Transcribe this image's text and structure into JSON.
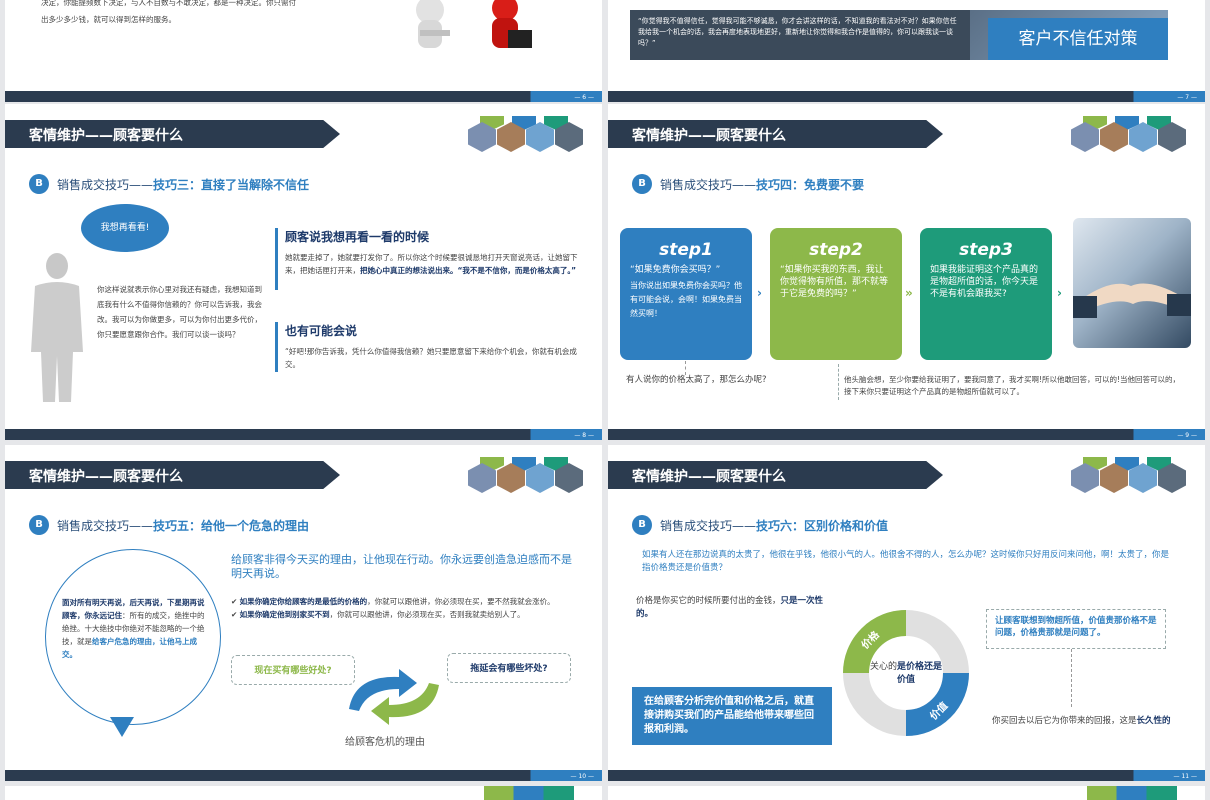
{
  "colors": {
    "navy": "#2b3b4f",
    "blue": "#2f7fc0",
    "green": "#8db84a",
    "teal": "#1e9b7a",
    "text": "#444444"
  },
  "common": {
    "section_title": "客情维护——顾客要什么",
    "badge": "B",
    "prefix": "销售成交技巧——"
  },
  "slide6": {
    "text1": "决定，你能提频数下决定，与人不自数与不敢决定，都是一种决定。你只需付",
    "text2": "出多少多少钱，就可以得到怎样的服务。",
    "page": "— 6 —"
  },
  "slide7": {
    "quote": "“你觉得我不值得信任，觉得我可能不够诚恳，你才会讲这样的话，不知道我的看法对不对？如果你信任我给我一个机会的话，我会再度地表现地更好，重新地让你觉得和我合作是值得的，你可以跟我谈一谈吗？”",
    "label": "客户不信任对策",
    "page": "— 7 —"
  },
  "slide8": {
    "tip": "技巧三：直接了当解除不信任",
    "bubble": "我想再看看!",
    "left_text": "你这样说就表示你心里对我还有疑虑，我想知道到底我有什么不值得你信赖的？你可以告诉我，我会改。我可以为你做更多，可以为你付出更多代价，你只要愿意跟你合作。我们可以谈一谈吗？",
    "h1": "顾客说我想再看一看的时候",
    "p1a": "她就要走掉了，她就要打发你了。所以你这个时候要很诚恳地打开天窗说亮话，让她留下来，把她话匣打开来，",
    "p1b": "把她心中真正的想法说出来。“我不是不信你，而是价格太高了。”",
    "h2": "也有可能会说",
    "p2": "“好吧!那你告诉我，凭什么你值得我信赖？她只要愿意留下来给你个机会，你就有机会成交。",
    "page": "— 8 —"
  },
  "slide9": {
    "tip": "技巧四：免费要不要",
    "steps": [
      {
        "title": "step1",
        "q": "“如果免费你会买吗？”",
        "a": "当你说出如果免费你会买吗？他有可能会说，会啊！如果免费当然买啊！"
      },
      {
        "title": "step2",
        "q": "“如果你买我的东西，我让你觉得物有所值，那不就等于它是免费的吗？”",
        "a": ""
      },
      {
        "title": "step3",
        "q": "如果我能证明这个产品真的是物超所值的话，你今天是不是有机会跟我买?",
        "a": ""
      }
    ],
    "bottom_left": "有人说你的价格太高了，那怎么办呢?",
    "bottom_right": "他头脑会想，至少你要给我证明了，要我同意了，我才买啊!所以他敢回答，可以的!当他回答可以的，接下来你只要证明这个产品真的是物超所值就可以了。",
    "page": "— 9 —"
  },
  "slide10": {
    "tip": "技巧五：给他一个危急的理由",
    "circle_a": "面对所有明天再说，后天再说，下星期再说顾客，你永远记住",
    "circle_b": "：所有的成交，绝挫中的绝挫。十大绝技中你绝对不能忽略的一个绝技，就是",
    "circle_c": "给客户危急的理由，让他马上成交。",
    "headline": "给顾客非得今天买的理由，让他现在行动。你永远要创造急迫感而不是明天再说。",
    "b1a": "如果你确定你给顾客的是最低的价格的",
    "b1b": "，你就可以跟他讲，你必须现在买，要不然我就会涨价。",
    "b2a": "如果你确定他到别家买不到",
    "b2b": "，你就可以跟他讲，你必须现在买，否则我就卖给别人了。",
    "box1": "现在买有哪些好处?",
    "box2": "拖延会有哪些坏处?",
    "caption": "给顾客危机的理由",
    "page": "— 10 —"
  },
  "slide11": {
    "tip": "技巧六：区别价格和价值",
    "intro": "如果有人还在那边说真的太贵了，他很在乎钱，他很小气的人。他很舍不得的人，怎么办呢？这时候你只好用反问来问他，啊！太贵了，你是指价格贵还是价值贵？",
    "left_a": "价格是你买它的时候所要付出的金钱，",
    "left_b": "只是一次性的。",
    "right_box": "让顾客联想到物超所值，价值贵那价格不是问题，价格贵那就是问题了。",
    "donut_price": "价格",
    "donut_value": "价值",
    "center_a": "关心的",
    "center_b": "是价格还是价值",
    "note": "在给顾客分析完价值和价格之后，就直接讲购买我们的产品能给他带来哪些回报和利润。",
    "right_bottom_a": "你买回去以后它为你带来的回报，这是",
    "right_bottom_b": "长久性的",
    "page": "— 11 —"
  }
}
